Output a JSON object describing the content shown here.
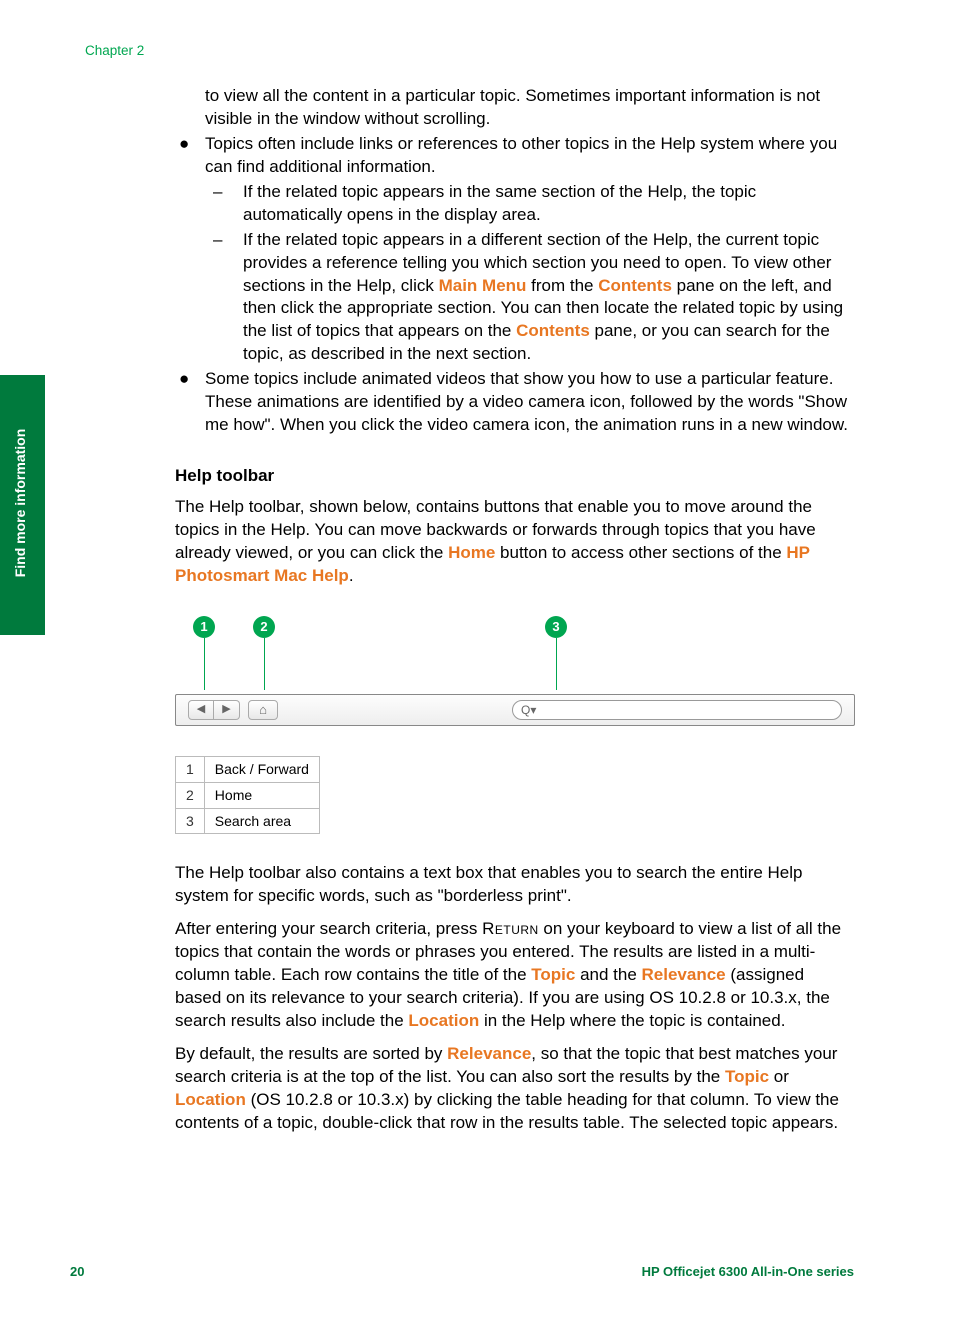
{
  "chapter": "Chapter 2",
  "sidebar_label": "Find more information",
  "intro_continued": "to view all the content in a particular topic. Sometimes important information is not visible in the window without scrolling.",
  "bullet_topics_intro": "Topics often include links or references to other topics in the Help system where you can find additional information.",
  "dash1": "If the related topic appears in the same section of the Help, the topic automatically opens in the display area.",
  "dash2_a": "If the related topic appears in a different section of the Help, the current topic provides a reference telling you which section you need to open. To view other sections in the Help, click ",
  "main_menu": "Main Menu",
  "dash2_b": " from the ",
  "contents": "Contents",
  "dash2_c": " pane on the left, and then click the appropriate section. You can then locate the related topic by using the list of topics that appears on the ",
  "dash2_d": " pane, or you can search for the topic, as described in the next section.",
  "bullet_videos": "Some topics include animated videos that show you how to use a particular feature. These animations are identified by a video camera icon, followed by the words \"Show me how\". When you click the video camera icon, the animation runs in a new window.",
  "help_toolbar_title": "Help toolbar",
  "help_toolbar_para_a": "The Help toolbar, shown below, contains buttons that enable you to move around the topics in the Help. You can move backwards or forwards through topics that you have already viewed, or you can click the ",
  "home": "Home",
  "help_toolbar_para_b": " button to access other sections of the ",
  "hp_photosmart": "HP Photosmart Mac Help",
  "period": ".",
  "callouts": {
    "c1": "1",
    "c2": "2",
    "c3": "3"
  },
  "search_glyph": "Q▾",
  "legend": [
    {
      "n": "1",
      "label": "Back / Forward"
    },
    {
      "n": "2",
      "label": "Home"
    },
    {
      "n": "3",
      "label": "Search area"
    }
  ],
  "toolbar_para2": "The Help toolbar also contains a text box that enables you to search the entire Help system for specific words, such as \"borderless print\".",
  "search_para_a": "After entering your search criteria, press ",
  "return_key": "Return",
  "search_para_b": " on your keyboard to view a list of all the topics that contain the words or phrases you entered. The results are listed in a multi-column table. Each row contains the title of the ",
  "topic": "Topic",
  "search_para_c": " and the ",
  "relevance": "Relevance",
  "search_para_d": " (assigned based on its relevance to your search criteria). If you are using OS 10.2.8 or 10.3.x, the search results also include the ",
  "location": "Location",
  "search_para_e": " in the Help where the topic is contained.",
  "sort_para_a": "By default, the results are sorted by ",
  "sort_para_b": ", so that the topic that best matches your search criteria is at the top of the list. You can also sort the results by the ",
  "sort_para_c": " or ",
  "sort_para_d": " (OS 10.2.8 or 10.3.x) by clicking the table heading for that column. To view the contents of a topic, double-click that row in the results table. The selected topic appears.",
  "page_number": "20",
  "brand_footer": "HP Officejet 6300 All-in-One series"
}
